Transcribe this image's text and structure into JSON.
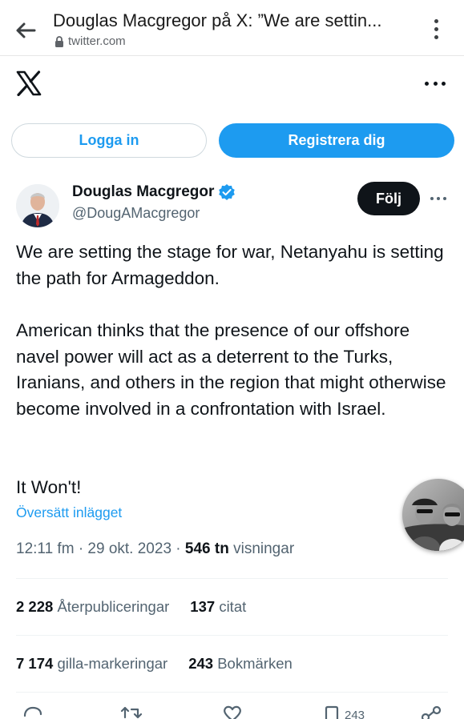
{
  "browser": {
    "title": "Douglas Macgregor på X: ”We are settin...",
    "url": "twitter.com"
  },
  "auth": {
    "login_label": "Logga in",
    "register_label": "Registrera dig"
  },
  "author": {
    "name": "Douglas Macgregor",
    "handle": "@DougAMacgregor",
    "follow_label": "Följ"
  },
  "tweet": {
    "paragraph1": "We are setting the stage for war, Netanyahu is setting the path for Armageddon.",
    "paragraph2": "American thinks that the presence of our offshore navel power will act as a deterrent to the Turks, Iranians, and others in the region that might otherwise become involved in a confrontation with Israel.",
    "paragraph3": "It Won't!",
    "translate_label": "Översätt inlägget",
    "time": "12:11 fm",
    "date": "29 okt. 2023",
    "views_count": "546 tn",
    "views_label": "visningar"
  },
  "stats": {
    "reposts_count": "2 228",
    "reposts_label": "Återpubliceringar",
    "quotes_count": "137",
    "quotes_label": "citat",
    "likes_count": "7 174",
    "likes_label": "gilla-markeringar",
    "bookmarks_count": "243",
    "bookmarks_label": "Bokmärken"
  },
  "actions": {
    "bookmark_count": "243"
  },
  "colors": {
    "accent": "#1d9bf0",
    "text": "#0f1419",
    "muted": "#536471",
    "verified": "#1d9bf0"
  },
  "icons": [
    "back-arrow-icon",
    "lock-icon",
    "kebab-menu-icon",
    "x-logo-icon",
    "more-horizontal-icon",
    "verified-badge-icon",
    "reply-icon",
    "repost-icon",
    "like-icon",
    "bookmark-icon",
    "share-icon"
  ]
}
